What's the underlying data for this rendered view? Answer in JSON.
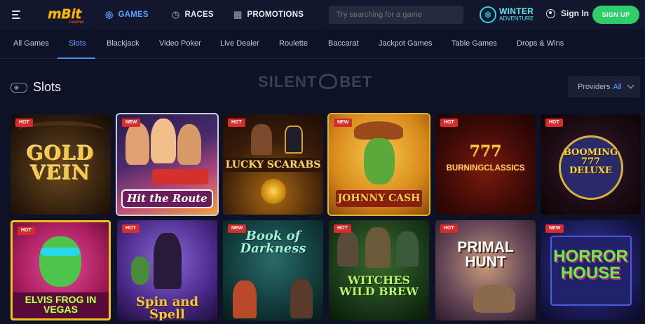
{
  "header": {
    "logo": "mBit",
    "logo_sub": "casino",
    "nav": [
      {
        "label": "GAMES",
        "icon": "controller-icon",
        "active": true
      },
      {
        "label": "RACES",
        "icon": "stopwatch-icon",
        "active": false
      },
      {
        "label": "PROMOTIONS",
        "icon": "gift-icon",
        "active": false
      }
    ],
    "search_placeholder": "Try searching for a game",
    "promo_line1": "WINTER",
    "promo_line2": "ADVENTURE",
    "signin_label": "Sign In",
    "signup_label": "SIGN UP"
  },
  "tabs": [
    "All Games",
    "Slots",
    "Blackjack",
    "Video Poker",
    "Live Dealer",
    "Roulette",
    "Baccarat",
    "Jackpot Games",
    "Table Games",
    "Drops & Wins"
  ],
  "active_tab": "Slots",
  "section": {
    "title": "Slots",
    "watermark_left": "SILENT",
    "watermark_right": "BET",
    "providers_label": "Providers",
    "providers_value": "All"
  },
  "games": [
    {
      "title": "GOLD VEIN",
      "badge": "HOT"
    },
    {
      "title": "Hit the Route",
      "badge": "NEW"
    },
    {
      "title": "LUCKY SCARABS",
      "badge": "HOT"
    },
    {
      "title": "JOHNNY CASH",
      "badge": "NEW"
    },
    {
      "title": "BURNINGCLASSICS",
      "badge": "HOT"
    },
    {
      "title": "BOOMING 777 DELUXE",
      "badge": "HOT"
    },
    {
      "title": "ELVIS FROG IN VEGAS",
      "badge": "HOT"
    },
    {
      "title": "Spin and Spell",
      "badge": "HOT"
    },
    {
      "title": "Book of Darkness",
      "badge": "NEW"
    },
    {
      "title": "WITCHES WILD BREW",
      "badge": "HOT"
    },
    {
      "title": "PRIMAL HUNT",
      "badge": "HOT"
    },
    {
      "title": "HORROR HOUSE",
      "badge": "NEW"
    }
  ],
  "colors": {
    "accent_blue": "#5fa0ff",
    "signup_green": "#2fce6a",
    "badge_red": "#d72c2c",
    "background": "#0e1226"
  }
}
